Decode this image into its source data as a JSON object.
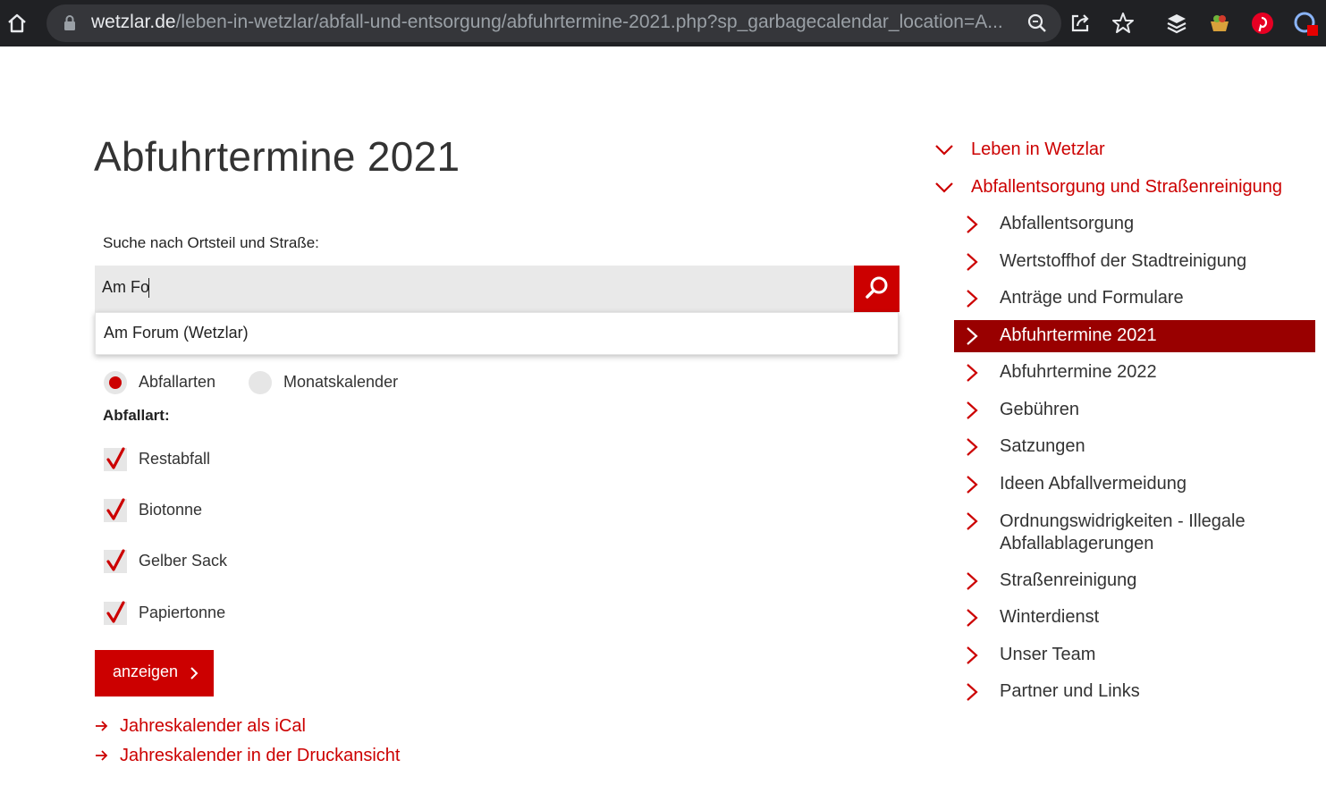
{
  "browser": {
    "url_host": "wetzlar.de",
    "url_path": "/leben-in-wetzlar/abfall-und-entsorgung/abfuhrtermine-2021.php?sp_garbagecalendar_location=A..."
  },
  "page": {
    "title": "Abfuhrtermine 2021",
    "search_label": "Suche nach Ortsteil und Straße:",
    "search_value": "Am Fo",
    "suggestion": "Am Forum (Wetzlar)",
    "view_options": [
      {
        "label": "Abfallarten",
        "selected": true
      },
      {
        "label": "Monatskalender",
        "selected": false
      }
    ],
    "waste_type_label": "Abfallart:",
    "waste_types": [
      {
        "label": "Restabfall",
        "checked": true
      },
      {
        "label": "Biotonne",
        "checked": true
      },
      {
        "label": "Gelber Sack",
        "checked": true
      },
      {
        "label": "Papiertonne",
        "checked": true
      }
    ],
    "submit_label": "anzeigen",
    "links": [
      "Jahreskalender als iCal",
      "Jahreskalender in der Druckansicht"
    ]
  },
  "nav": {
    "parents": [
      "Leben in Wetzlar",
      "Abfallentsorgung und Straßenreinigung"
    ],
    "items": [
      "Abfallentsorgung",
      "Wertstoffhof der Stadtreinigung",
      "Anträge und Formulare",
      "Abfuhrtermine 2021",
      "Abfuhrtermine 2022",
      "Gebühren",
      "Satzungen",
      "Ideen Abfallvermeidung",
      "Ordnungswidrigkeiten - Illegale Abfallablagerungen",
      "Straßenreinigung",
      "Winterdienst",
      "Unser Team",
      "Partner und Links"
    ],
    "active_item": "Abfuhrtermine 2021"
  },
  "colors": {
    "accent": "#cc0000",
    "active_nav": "#990000",
    "chrome": "#202124"
  }
}
